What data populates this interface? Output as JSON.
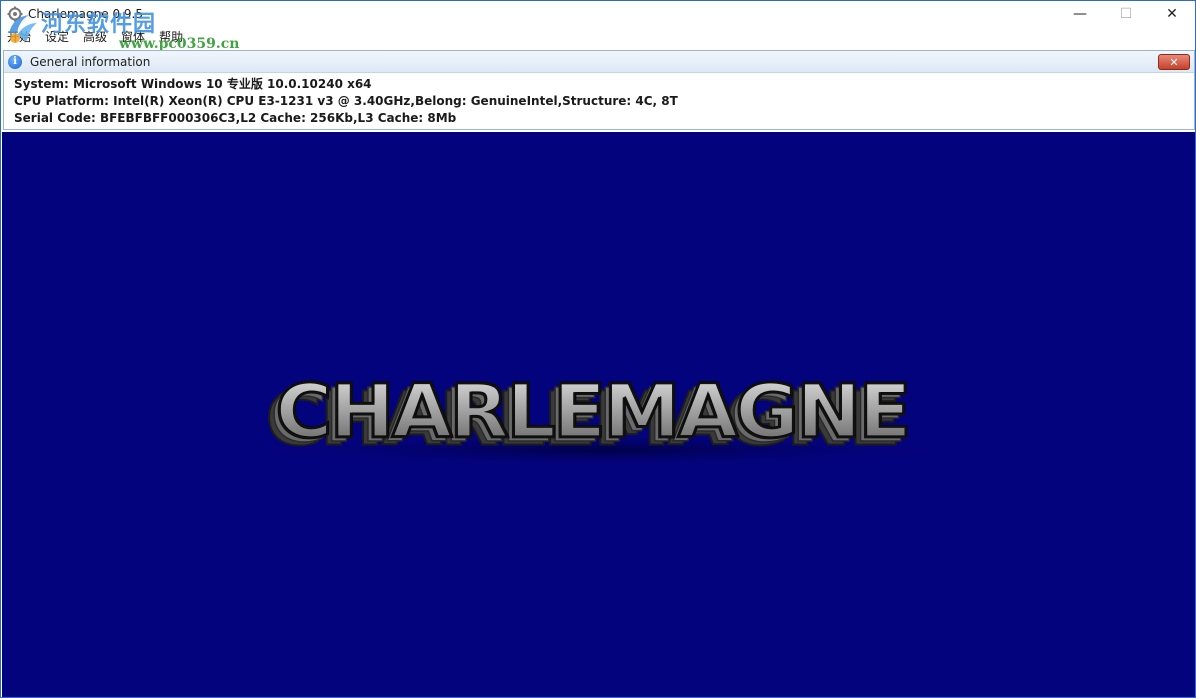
{
  "window": {
    "title": "Charlemagne 0.9.5",
    "controls": {
      "minimize": "—",
      "maximize": "☐",
      "close": "✕"
    }
  },
  "watermark": {
    "title": "河东软件园",
    "url": "www.pc0359.cn"
  },
  "menu": {
    "items": [
      "开始",
      "设定",
      "高级",
      "窗体",
      "帮助"
    ]
  },
  "info_panel": {
    "title": "General information",
    "close_label": "✕",
    "lines": [
      "System: Microsoft Windows 10 专业版 10.0.10240 x64",
      "CPU Platform: Intel(R) Xeon(R) CPU E3-1231 v3 @ 3.40GHz,Belong: GenuineIntel,Structure: 4C, 8T",
      "Serial Code: BFEBFBFF000306C3,L2 Cache: 256Kb,L3 Cache: 8Mb"
    ]
  },
  "logo": {
    "text": "CHARLEMAGNE"
  },
  "colors": {
    "canvas_bg": "#04037e",
    "accent": "#2b6cc4"
  }
}
